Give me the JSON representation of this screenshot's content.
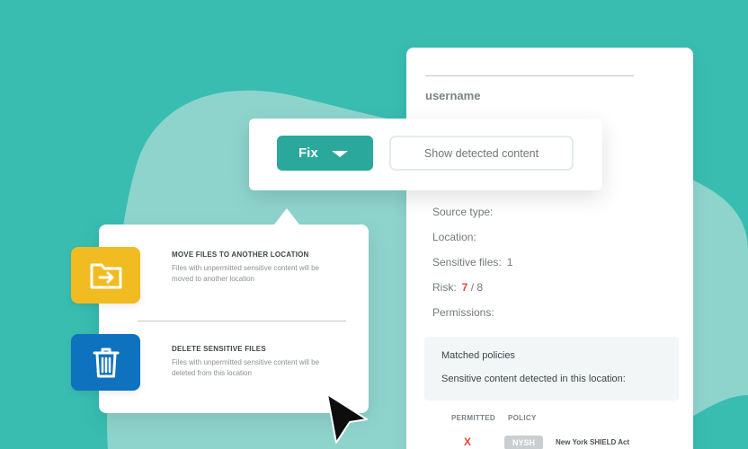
{
  "detail_card": {
    "username": "username",
    "fields": {
      "source_type_label": "Source type:",
      "location_label": "Location:",
      "sensitive_files_label": "Sensitive files:",
      "sensitive_files_value": "1",
      "risk_label": "Risk:",
      "risk_value": "7",
      "risk_max": "/ 8",
      "permissions_label": "Permissions:"
    },
    "policies_box": {
      "matched": "Matched policies",
      "sensitive": "Sensitive content detected in this location:"
    },
    "table": {
      "headers": [
        "PERMITTED",
        "POLICY"
      ],
      "rows": [
        {
          "permitted": "X",
          "tag": "NYSH",
          "name": "New York SHIELD Act"
        }
      ]
    }
  },
  "action_bar": {
    "fix_label": "Fix",
    "show_label": "Show detected content"
  },
  "fix_menu": {
    "items": [
      {
        "title": "MOVE FILES TO ANOTHER LOCATION",
        "description": "Files with unpermitted sensitive content will be moved to another location",
        "icon": "folder-move-icon"
      },
      {
        "title": "DELETE SENSITIVE FILES",
        "description": "Files with unpermitted sensitive content will be deleted from this location",
        "icon": "trash-icon"
      }
    ]
  },
  "colors": {
    "background": "#39bdb1",
    "accent": "#2aa89b",
    "move_tile": "#f1bc22",
    "delete_tile": "#0e72bf",
    "risk": "#e0473a"
  }
}
